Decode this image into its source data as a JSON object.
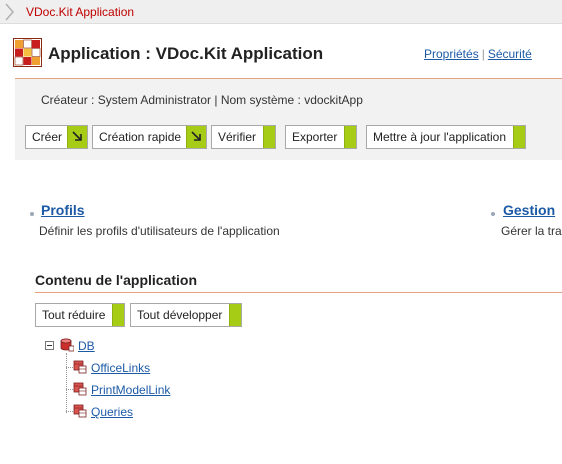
{
  "breadcrumb": {
    "label": "VDoc.Kit Application"
  },
  "header": {
    "title": "Application : VDoc.Kit Application",
    "links": [
      "Propriétés",
      "Sécurité"
    ],
    "meta": "Créateur : System Administrator |  Nom système : vdockitApp"
  },
  "toolbar": {
    "create": "Créer",
    "quick_create": "Création rapide",
    "verify": "Vérifier",
    "export": "Exporter",
    "update": "Mettre à jour l'application"
  },
  "menu": [
    {
      "title": "Profils",
      "desc": "Définir les profils d'utilisateurs de l'application"
    },
    {
      "title": "Gestion",
      "desc": "Gérer la tra"
    }
  ],
  "content": {
    "title": "Contenu de l'application",
    "collapse_all": "Tout réduire",
    "expand_all": "Tout développer",
    "tree": {
      "root": "DB",
      "children": [
        "OfficeLinks",
        "PrintModelLink",
        "Queries"
      ]
    }
  },
  "colors": {
    "accent": "#c00000",
    "link": "#1c5aa6",
    "button_tail": "#a6cc16",
    "rule": "#e6a07c"
  }
}
